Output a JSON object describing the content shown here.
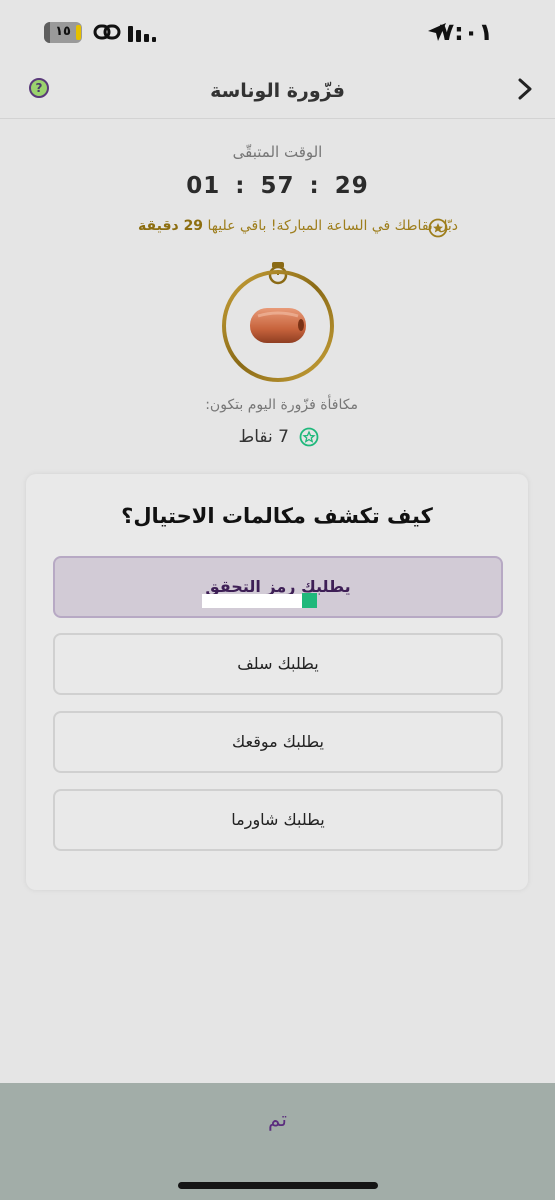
{
  "status_bar": {
    "time": "٧:٠١",
    "battery": "١٥",
    "battery_level_percent": 15,
    "icons": [
      "location-arrow-icon",
      "battery-icon",
      "link-icon",
      "signal-icon"
    ]
  },
  "header": {
    "title": "فزّورة الوناسة",
    "back_icon": "chevron-right-icon",
    "help_icon": "question-icon"
  },
  "timer": {
    "label": "الوقت المتبقّى",
    "countdown": "01 : 57 : 29"
  },
  "promo": {
    "text": "دبّل نقاطك في الساعة المباركة! باقي عليها ",
    "highlight": "29 دقيقة",
    "icon": "star-badge-icon"
  },
  "reward": {
    "label": "مكافأة فزّورة اليوم بتكون:",
    "value": "7 نقاط",
    "icon": "star-badge-icon"
  },
  "question": {
    "text": "كيف تكشف مكالمات الاحتيال؟",
    "options": [
      {
        "label": "يطلبك رمز التحقق",
        "selected": true
      },
      {
        "label": "يطلبك سلف",
        "selected": false
      },
      {
        "label": "يطلبك موقعك",
        "selected": false
      },
      {
        "label": "يطلبك شاورما",
        "selected": false
      }
    ]
  },
  "footer": {
    "done_label": "تم"
  },
  "colors": {
    "background": "#e5e5e5",
    "accent_purple": "#5b2d7e",
    "gold": "#9e7e1c",
    "green": "#1fb87b",
    "bottom_bar": "#a2ada8"
  }
}
